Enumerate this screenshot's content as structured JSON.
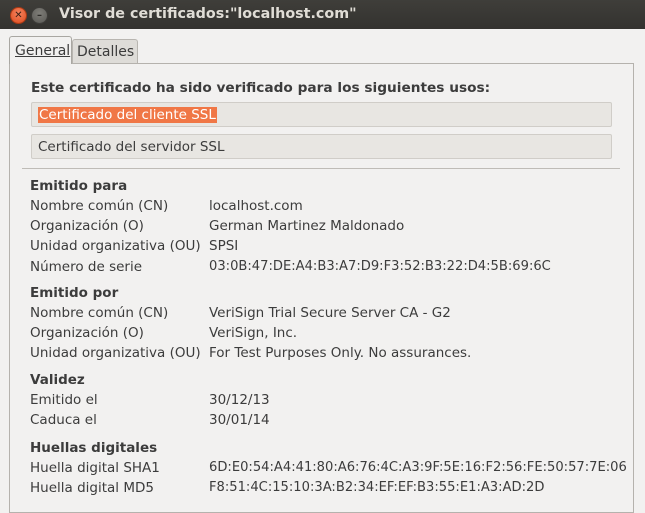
{
  "window": {
    "title": "Visor de certificados:\"localhost.com\"",
    "close_glyph": "✕",
    "min_glyph": "–"
  },
  "tabs": {
    "general": "General",
    "details": "Detalles"
  },
  "usage": {
    "heading": "Este certificado ha sido verificado para los siguientes usos:",
    "items": [
      "Certificado del cliente SSL",
      "Certificado del servidor SSL"
    ]
  },
  "issued_to": {
    "heading": "Emitido para",
    "rows": [
      {
        "label": "Nombre común (CN)",
        "value": "localhost.com"
      },
      {
        "label": "Organización (O)",
        "value": "German Martinez Maldonado"
      },
      {
        "label": "Unidad organizativa (OU)",
        "value": "SPSI"
      },
      {
        "label": "Número de serie",
        "value": "03:0B:47:DE:A4:B3:A7:D9:F3:52:B3:22:D4:5B:69:6C"
      }
    ]
  },
  "issued_by": {
    "heading": "Emitido por",
    "rows": [
      {
        "label": "Nombre común (CN)",
        "value": "VeriSign Trial Secure Server CA - G2"
      },
      {
        "label": "Organización (O)",
        "value": "VeriSign, Inc."
      },
      {
        "label": "Unidad organizativa (OU)",
        "value": "For Test Purposes Only.  No assurances."
      }
    ]
  },
  "validity": {
    "heading": "Validez",
    "rows": [
      {
        "label": "Emitido el",
        "value": "30/12/13"
      },
      {
        "label": "Caduca el",
        "value": "30/01/14"
      }
    ]
  },
  "fingerprints": {
    "heading": "Huellas digitales",
    "rows": [
      {
        "label": "Huella digital SHA1",
        "value": "6D:E0:54:A4:41:80:A6:76:4C:A3:9F:5E:16:F2:56:FE:50:57:7E:06"
      },
      {
        "label": "Huella digital MD5",
        "value": "F8:51:4C:15:10:3A:B2:34:EF:EF:B3:55:E1:A3:AD:2D"
      }
    ]
  }
}
